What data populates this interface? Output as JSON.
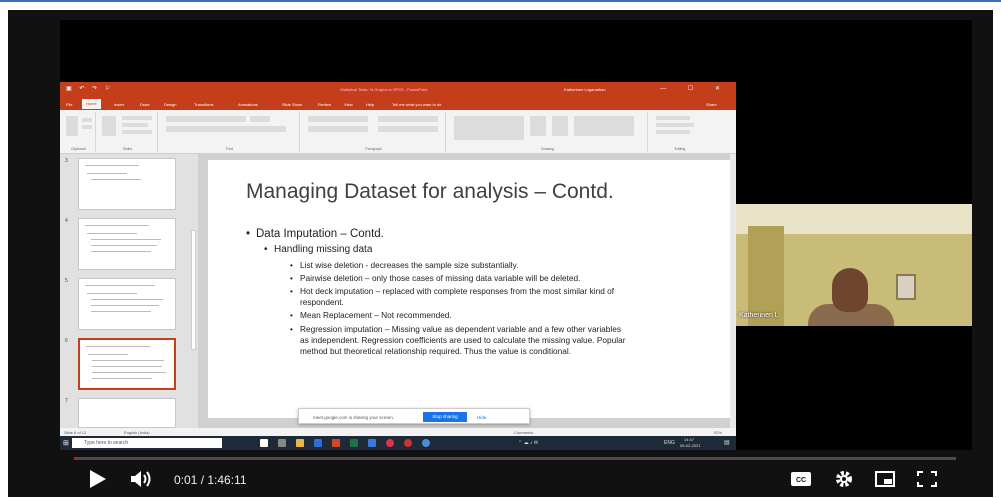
{
  "ppt": {
    "title": "Statistical Tests: % Graphs in SPSS - PowerPoint",
    "user": "Katherinen Loganathan",
    "tabs": [
      "File",
      "Home",
      "Insert",
      "Draw",
      "Design",
      "Transitions",
      "Animations",
      "Slide Show",
      "Review",
      "View",
      "Help",
      "Tell me what you want to do"
    ],
    "share": "Share",
    "ribbon_groups": [
      "Clipboard",
      "Slides",
      "Font",
      "Paragraph",
      "Drawing",
      "Editing"
    ],
    "thumb_numbers": [
      "3",
      "4",
      "5",
      "6",
      "7"
    ],
    "status_left": "Slide 6 of 12",
    "status_lang": "English (India)",
    "status_comments": "Comments",
    "status_zoom": "52%"
  },
  "slide": {
    "title": "Managing Dataset for analysis – Contd.",
    "bullet1": "Data Imputation – Contd.",
    "bullet2": "Handling missing data",
    "items": [
      [
        "List wise deletion -  decreases the sample size substantially."
      ],
      [
        "Pairwise deletion – only those cases of missing data variable will be deleted."
      ],
      [
        "Hot deck imputation – replaced with complete responses from the most similar kind of",
        "respondent."
      ],
      [
        "Mean Replacement – Not recommended."
      ],
      [
        "Regression imputation – Missing value as dependent variable and a few other variables",
        "as independent. Regression coefficients are used to calculate the missing value. Popular",
        "method but theoretical relationship required. Thus the value is conditional."
      ]
    ]
  },
  "sharebar": {
    "message": "meet.google.com is sharing your screen.",
    "stop": "Stop sharing",
    "hide": "Hide"
  },
  "taskbar": {
    "search": "Type here to search",
    "lang": "ENG",
    "time": "14:47",
    "date": "06-02-2021"
  },
  "camera": {
    "name": "Katherinen L"
  },
  "player": {
    "time": "0:01 / 1:46:11",
    "progress_fraction": 0.0002,
    "colors": {
      "progress": "#ff0000",
      "ppt_accent": "#c43e1c"
    }
  }
}
